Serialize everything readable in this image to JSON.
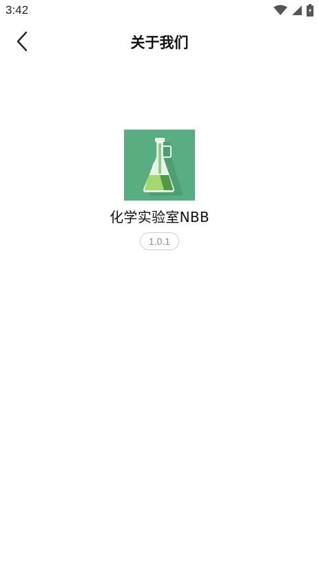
{
  "status_bar": {
    "time": "3:42",
    "icons": [
      "wifi-icon",
      "signal-icon",
      "battery-icon"
    ]
  },
  "header": {
    "title": "关于我们",
    "back_icon": "chevron-left-icon"
  },
  "app": {
    "name": "化学实验室NBB",
    "version": "1.0.1",
    "icon": "flask-icon",
    "icon_bg_color": "#58ae80"
  }
}
